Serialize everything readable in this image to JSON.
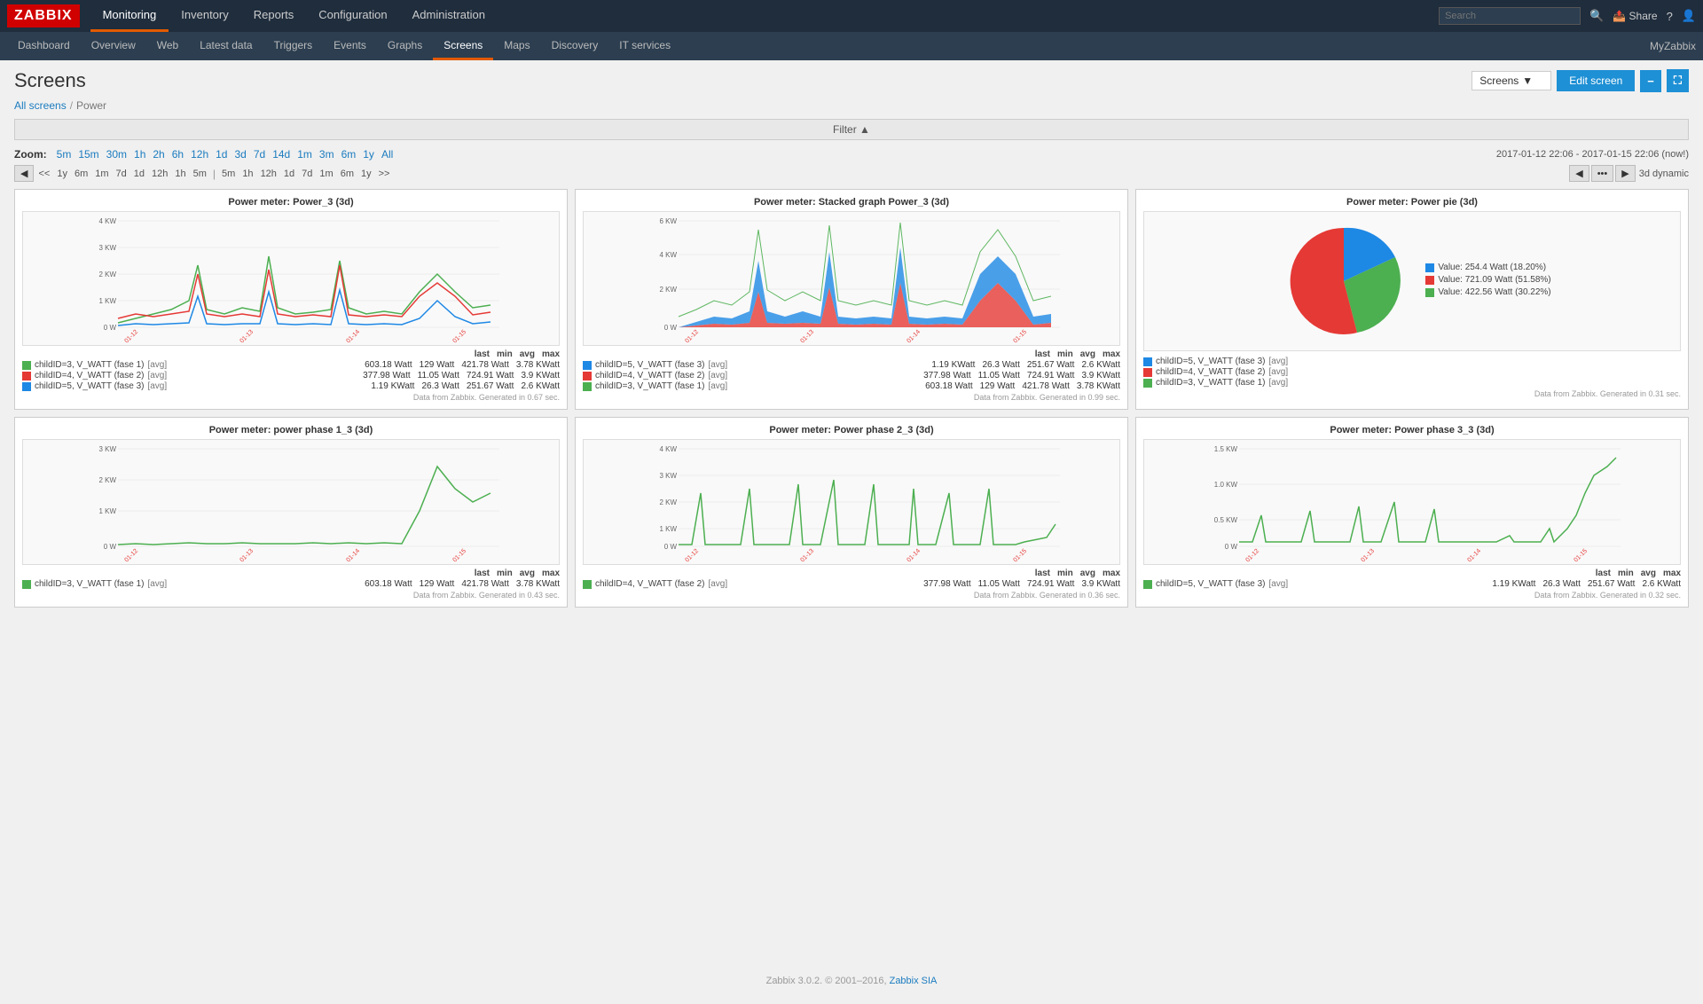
{
  "logo": "ZABBIX",
  "top_nav": {
    "items": [
      {
        "label": "Monitoring",
        "active": true
      },
      {
        "label": "Inventory",
        "active": false
      },
      {
        "label": "Reports",
        "active": false
      },
      {
        "label": "Configuration",
        "active": false
      },
      {
        "label": "Administration",
        "active": false
      }
    ],
    "right": {
      "search_placeholder": "Search",
      "share": "Share",
      "help": "?",
      "user": "👤"
    }
  },
  "sub_nav": {
    "items": [
      {
        "label": "Dashboard"
      },
      {
        "label": "Overview"
      },
      {
        "label": "Web"
      },
      {
        "label": "Latest data"
      },
      {
        "label": "Triggers"
      },
      {
        "label": "Events"
      },
      {
        "label": "Graphs"
      },
      {
        "label": "Screens",
        "active": true
      },
      {
        "label": "Maps"
      },
      {
        "label": "Discovery"
      },
      {
        "label": "IT services"
      }
    ],
    "myzabbix": "MyZabbix"
  },
  "page": {
    "title": "Screens",
    "dropdown_label": "Screens",
    "edit_screen": "Edit screen",
    "breadcrumb": {
      "all_screens": "All screens",
      "sep": "/",
      "current": "Power"
    },
    "filter_label": "Filter ▲"
  },
  "zoom": {
    "label": "Zoom:",
    "options": [
      "5m",
      "15m",
      "30m",
      "1h",
      "2h",
      "6h",
      "12h",
      "1d",
      "3d",
      "7d",
      "14d",
      "1m",
      "3m",
      "6m",
      "1y",
      "All"
    ]
  },
  "time_range": "2017-01-12 22:06 - 2017-01-15 22:06 (now!)",
  "nav_links": [
    "<<",
    "1y",
    "6m",
    "1m",
    "7d",
    "1d",
    "12h",
    "1h",
    "5m",
    "|",
    "5m",
    "1h",
    "12h",
    "1d",
    "7d",
    "1m",
    "6m",
    "1y",
    ">>"
  ],
  "nav_period": "3d dynamic",
  "charts": {
    "row1": [
      {
        "title": "Power meter: Power_3 (3d)",
        "type": "line",
        "y_labels": [
          "4 KWatt",
          "3 KWatt",
          "2 KWatt",
          "1 KWatt",
          "0 Watt"
        ],
        "legend": [
          {
            "color": "#4caf50",
            "label": "childID=3, V_WATT (fase 1)",
            "tag": "[avg]",
            "last": "603.18 Watt",
            "min": "129 Watt",
            "avg": "421.78 Watt",
            "max": "3.78 KWatt"
          },
          {
            "color": "#e53935",
            "label": "childID=4, V_WATT (fase 2)",
            "tag": "[avg]",
            "last": "377.98 Watt",
            "min": "11.05 Watt",
            "avg": "724.91 Watt",
            "max": "3.9 KWatt"
          },
          {
            "color": "#1e88e5",
            "label": "childID=5, V_WATT (fase 3)",
            "tag": "[avg]",
            "last": "1.19 KWatt",
            "min": "26.3 Watt",
            "avg": "251.67 Watt",
            "max": "2.6 KWatt"
          }
        ],
        "footer": "Data from Zabbix, Generated in 0.67 sec."
      },
      {
        "title": "Power meter: Stacked graph Power_3 (3d)",
        "type": "stacked",
        "y_labels": [
          "6 KWatt",
          "4 KWatt",
          "2 KWatt",
          "0 Watt"
        ],
        "legend": [
          {
            "color": "#1e88e5",
            "label": "childID=5, V_WATT (fase 3)",
            "tag": "[avg]",
            "last": "1.19 KWatt",
            "min": "26.3 Watt",
            "avg": "251.67 Watt",
            "max": "2.6 KWatt"
          },
          {
            "color": "#e53935",
            "label": "childID=4, V_WATT (fase 2)",
            "tag": "[avg]",
            "last": "377.98 Watt",
            "min": "11.05 Watt",
            "avg": "724.91 Watt",
            "max": "3.9 KWatt"
          },
          {
            "color": "#4caf50",
            "label": "childID=3, V_WATT (fase 1)",
            "tag": "[avg]",
            "last": "603.18 Watt",
            "min": "129 Watt",
            "avg": "421.78 Watt",
            "max": "3.78 KWatt"
          }
        ],
        "footer": "Data from Zabbix, Generated in 0.99 sec."
      },
      {
        "title": "Power meter: Power pie (3d)",
        "type": "pie",
        "slices": [
          {
            "color": "#1e88e5",
            "label": "childID=5, V_WATT (fase 3)",
            "tag": "[avg]",
            "value": "Value: 254.4 Watt (18.20%)",
            "percent": 18.2
          },
          {
            "color": "#e53935",
            "label": "childID=4, V_WATT (fase 2)",
            "tag": "[avg]",
            "value": "Value: 721.09 Watt (51.58%)",
            "percent": 51.58
          },
          {
            "color": "#4caf50",
            "label": "childID=3, V_WATT (fase 1)",
            "tag": "[avg]",
            "value": "Value: 422.56 Watt (30.22%)",
            "percent": 30.22
          }
        ],
        "footer": "Data from Zabbix, Generated in 0.31 sec."
      }
    ],
    "row2": [
      {
        "title": "Power meter: power phase 1_3 (3d)",
        "type": "line_single",
        "y_labels": [
          "3 KWatt",
          "2 KWatt",
          "1 KWatt",
          "0 Watt"
        ],
        "legend": [
          {
            "color": "#4caf50",
            "label": "childID=3, V_WATT (fase 1)",
            "tag": "[avg]",
            "last": "603.18 Watt",
            "min": "129 Watt",
            "avg": "421.78 Watt",
            "max": "3.78 KWatt"
          }
        ],
        "footer": "Data from Zabbix, Generated in 0.43 sec."
      },
      {
        "title": "Power meter: Power phase 2_3 (3d)",
        "type": "line_single",
        "y_labels": [
          "4 KWatt",
          "3 KWatt",
          "2 KWatt",
          "1 KWatt",
          "0 Watt"
        ],
        "legend": [
          {
            "color": "#4caf50",
            "label": "childID=4, V_WATT (fase 2)",
            "tag": "[avg]",
            "last": "377.98 Watt",
            "min": "11.05 Watt",
            "avg": "724.91 Watt",
            "max": "3.9 KWatt"
          }
        ],
        "footer": "Data from Zabbix, Generated in 0.36 sec."
      },
      {
        "title": "Power meter: Power phase 3_3 (3d)",
        "type": "line_single",
        "y_labels": [
          "1.5 KWatt",
          "1.0 KWatt",
          "0.5 KWatt",
          "0 Watt"
        ],
        "legend": [
          {
            "color": "#4caf50",
            "label": "childID=5, V_WATT (fase 3)",
            "tag": "[avg]",
            "last": "1.19 KWatt",
            "min": "26.3 Watt",
            "avg": "251.67 Watt",
            "max": "2.6 KWatt"
          }
        ],
        "footer": "Data from Zabbix, Generated in 0.32 sec."
      }
    ]
  },
  "footer": {
    "text": "Zabbix 3.0.2. © 2001–2016,",
    "link_text": "Zabbix SIA"
  }
}
